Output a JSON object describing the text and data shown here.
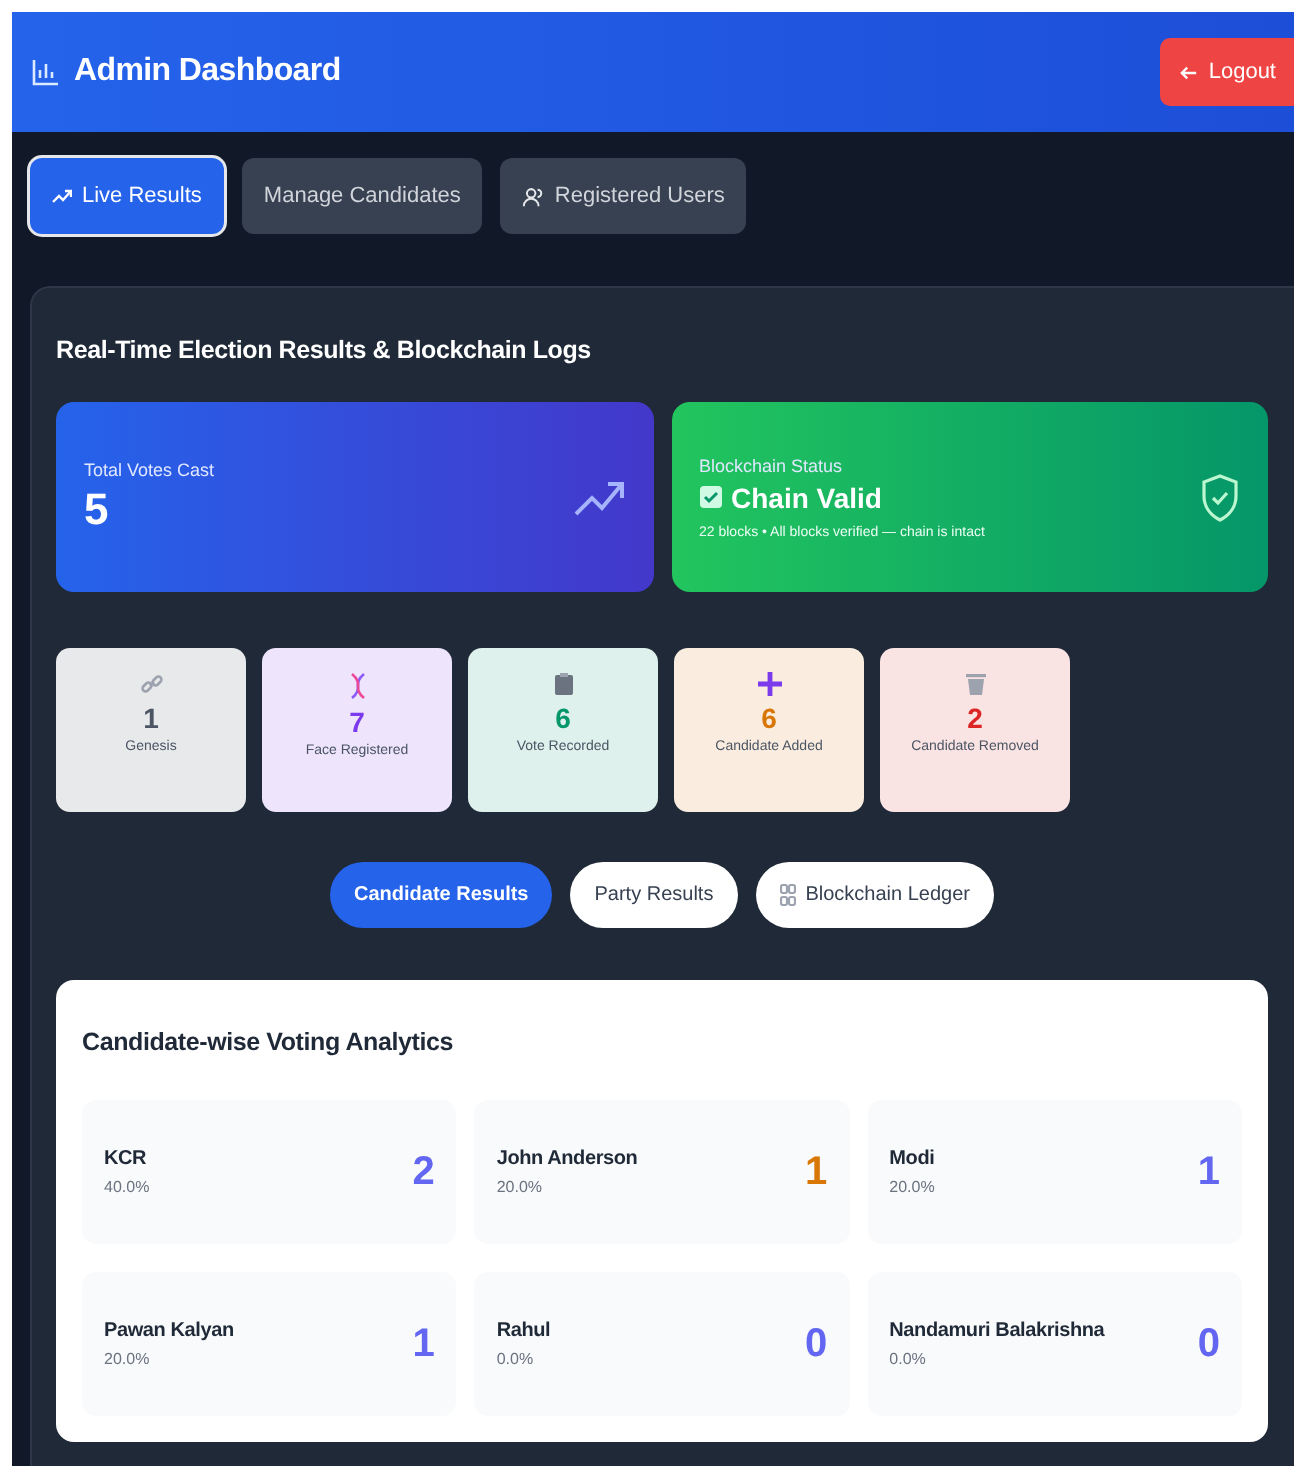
{
  "header": {
    "title": "Admin Dashboard",
    "logout": "Logout"
  },
  "tabs": [
    {
      "label": "Live Results",
      "selected": true
    },
    {
      "label": "Manage Candidates",
      "selected": false
    },
    {
      "label": "Registered Users",
      "selected": false
    }
  ],
  "panel": {
    "title": "Real-Time Election Results & Blockchain Logs",
    "total_votes": {
      "label": "Total Votes Cast",
      "value": "5"
    },
    "blockchain_status": {
      "label": "Blockchain Status",
      "status": "Chain Valid",
      "valid": true,
      "detail": "22 blocks • All blocks verified — chain is intact"
    },
    "events": [
      {
        "count": "1",
        "label": "Genesis",
        "color": "#4b5563"
      },
      {
        "count": "7",
        "label": "Face Registered",
        "color": "#7c3aed"
      },
      {
        "count": "6",
        "label": "Vote Recorded",
        "color": "#059669"
      },
      {
        "count": "6",
        "label": "Candidate Added",
        "color": "#d97706"
      },
      {
        "count": "2",
        "label": "Candidate Removed",
        "color": "#dc2626"
      }
    ],
    "result_tabs": [
      {
        "label": "Candidate Results",
        "selected": true
      },
      {
        "label": "Party Results",
        "selected": false
      },
      {
        "label": "Blockchain Ledger",
        "selected": false
      }
    ],
    "analytics": {
      "title": "Candidate-wise Voting Analytics",
      "candidates": [
        {
          "name": "KCR",
          "percent": "40.0%",
          "votes": "2",
          "color": "#6366f1"
        },
        {
          "name": "John Anderson",
          "percent": "20.0%",
          "votes": "1",
          "color": "#d97706"
        },
        {
          "name": "Modi",
          "percent": "20.0%",
          "votes": "1",
          "color": "#6366f1"
        },
        {
          "name": "Pawan Kalyan",
          "percent": "20.0%",
          "votes": "1",
          "color": "#6366f1"
        },
        {
          "name": "Rahul",
          "percent": "0.0%",
          "votes": "0",
          "color": "#6366f1"
        },
        {
          "name": "Nandamuri Balakrishna",
          "percent": "0.0%",
          "votes": "0",
          "color": "#6366f1"
        }
      ]
    }
  }
}
